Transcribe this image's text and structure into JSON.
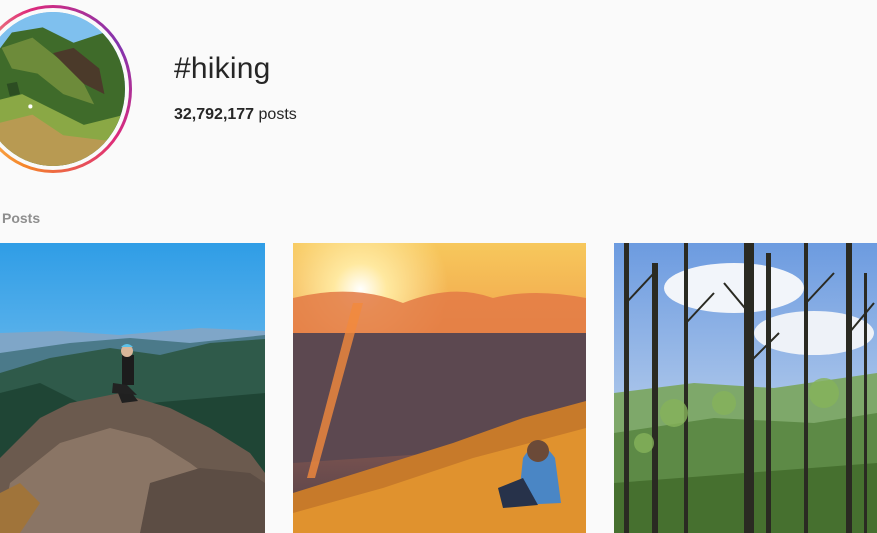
{
  "header": {
    "hashtag": "#hiking",
    "post_count": "32,792,177",
    "post_count_suffix": "posts"
  },
  "section": {
    "label": "Posts"
  },
  "avatar": {
    "icon": "hashtag-avatar-image",
    "ring_colors": [
      "#f58529",
      "#feda77",
      "#dd2a7b",
      "#8134af"
    ]
  },
  "posts": [
    {
      "icon": "post-thumbnail-mountain-summit"
    },
    {
      "icon": "post-thumbnail-sunset-hillside"
    },
    {
      "icon": "post-thumbnail-forest-trees"
    }
  ]
}
